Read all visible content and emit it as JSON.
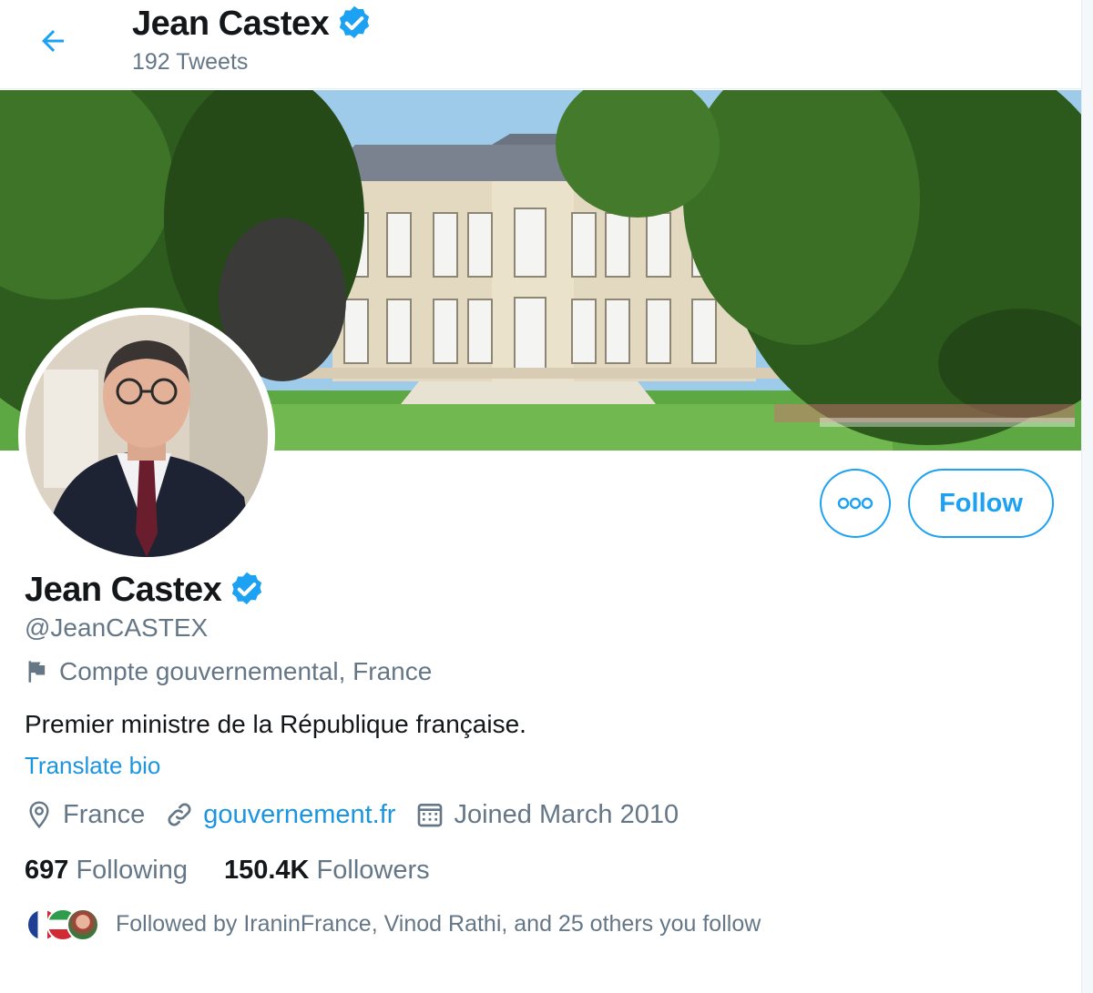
{
  "header": {
    "name": "Jean Castex",
    "tweet_count": "192 Tweets"
  },
  "profile": {
    "name": "Jean Castex",
    "handle": "@JeanCASTEX",
    "gov_label": "Compte gouvernemental, France",
    "bio": "Premier ministre de la République française.",
    "translate_bio": "Translate bio",
    "location": "France",
    "website": "gouvernement.fr",
    "joined": "Joined March 2010"
  },
  "actions": {
    "follow_label": "Follow"
  },
  "stats": {
    "following_count": "697",
    "following_label": "Following",
    "followers_count": "150.4K",
    "followers_label": "Followers"
  },
  "followed_by": "Followed by IraninFrance, Vinod Rathi, and 25 others you follow",
  "colors": {
    "accent": "#1da1f2",
    "link": "#1b95e0",
    "secondary_text": "#657786",
    "primary_text": "#14171a"
  },
  "icons": [
    "back-arrow-icon",
    "verified-badge-icon",
    "more-options-icon",
    "flag-icon",
    "location-pin-icon",
    "link-icon",
    "calendar-icon"
  ]
}
